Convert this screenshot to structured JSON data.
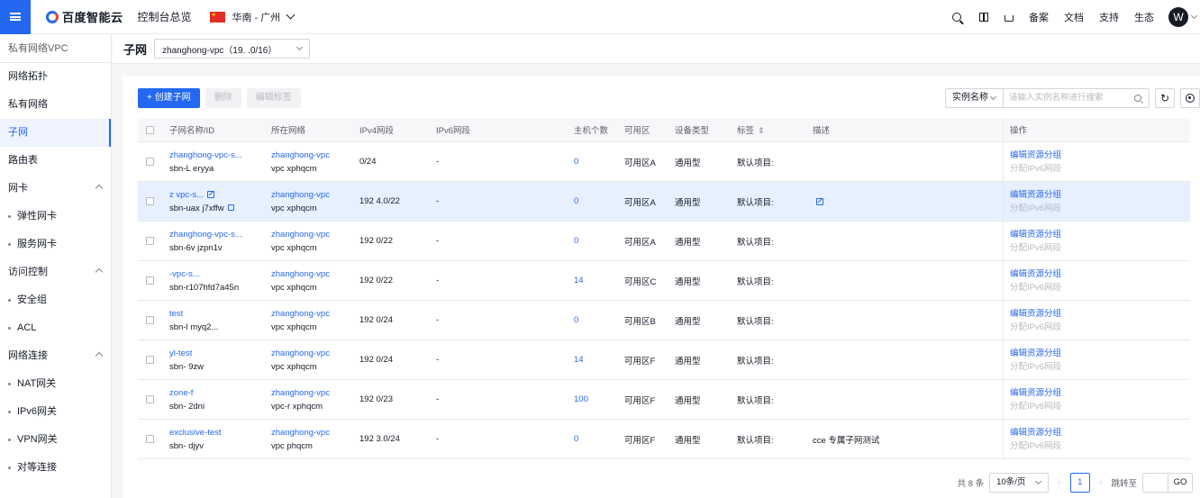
{
  "topbar": {
    "logo_text": "百度智能云",
    "console_label": "控制台总览",
    "region_label": "华南 - 广州",
    "links": [
      "备案",
      "文档",
      "支持",
      "生态"
    ],
    "avatar_letter": "W"
  },
  "sidebar": {
    "title": "私有网络VPC",
    "items": [
      {
        "label": "网络拓扑"
      },
      {
        "label": "私有网络"
      },
      {
        "label": "子网"
      },
      {
        "label": "路由表"
      },
      {
        "label": "网卡"
      },
      {
        "label": "弹性网卡"
      },
      {
        "label": "服务网卡"
      },
      {
        "label": "访问控制"
      },
      {
        "label": "安全组"
      },
      {
        "label": "ACL"
      },
      {
        "label": "网络连接"
      },
      {
        "label": "NAT网关"
      },
      {
        "label": "IPv6网关"
      },
      {
        "label": "VPN网关"
      },
      {
        "label": "对等连接"
      }
    ]
  },
  "main": {
    "title": "子网",
    "vpc_select_value": "zhanghong-vpc（19.       .0/16）"
  },
  "toolbar": {
    "create_label": "+ 创建子网",
    "delete_label": "删除",
    "edit_tags_label": "编辑标签",
    "filter_label": "实例名称",
    "search_placeholder": "请输入实例名称进行搜索"
  },
  "table": {
    "headers": {
      "name": "子网名称/ID",
      "vpc": "所在网络",
      "ipv4": "IPv4网段",
      "ipv6": "IPv6网段",
      "hosts": "主机个数",
      "zone": "可用区",
      "type": "设备类型",
      "tag": "标签",
      "desc": "描述",
      "ops": "操作"
    },
    "rows": [
      {
        "name": "zhanghong-vpc-s...",
        "id": "sbn-L        eryya",
        "vpc": "zhanghong-vpc",
        "vpc_id": "vpc        xphqcm",
        "ipv4": "        0/24",
        "ipv6": "-",
        "hosts": "0",
        "zone": "可用区A",
        "type": "通用型",
        "tag": "默认项目:",
        "desc": "",
        "op1": "编辑资源分组",
        "op2": "分配IPv6网段"
      },
      {
        "name": "z            vpc-s...",
        "id": "sbn-uax      j7xffw",
        "vpc": "zhanghong-vpc",
        "vpc_id": "vpc        xphqcm",
        "ipv4": "192        4.0/22",
        "ipv6": "-",
        "hosts": "0",
        "zone": "可用区A",
        "type": "通用型",
        "tag": "默认项目:",
        "desc": "",
        "op1": "编辑资源分组",
        "op2": "分配IPv6网段"
      },
      {
        "name": "zhanghong-vpc-s...",
        "id": "sbn-6v      jzpn1v",
        "vpc": "zhanghong-vpc",
        "vpc_id": "vpc        xphqcm",
        "ipv4": "192        0/22",
        "ipv6": "-",
        "hosts": "0",
        "zone": "可用区A",
        "type": "通用型",
        "tag": "默认项目:",
        "desc": "",
        "op1": "编辑资源分组",
        "op2": "分配IPv6网段"
      },
      {
        "name": "            -vpc-s...",
        "id": "sbn-r107hfd7a45n",
        "vpc": "zhanghong-vpc",
        "vpc_id": "vpc        xphqcm",
        "ipv4": "192        0/22",
        "ipv6": "-",
        "hosts": "14",
        "zone": "可用区C",
        "type": "通用型",
        "tag": "默认项目:",
        "desc": "",
        "op1": "编辑资源分组",
        "op2": "分配IPv6网段"
      },
      {
        "name": "test",
        "id": "sbn-l        myq2...",
        "vpc": "zhanghong-vpc",
        "vpc_id": "vpc        xphqcm",
        "ipv4": "192        0/24",
        "ipv6": "-",
        "hosts": "0",
        "zone": "可用区B",
        "type": "通用型",
        "tag": "默认项目:",
        "desc": "",
        "op1": "编辑资源分组",
        "op2": "分配IPv6网段"
      },
      {
        "name": "yl-test",
        "id": "sbn-         9zw",
        "vpc": "zhanghong-vpc",
        "vpc_id": "vpc        xphqcm",
        "ipv4": "192        0/24",
        "ipv6": "-",
        "hosts": "14",
        "zone": "可用区F",
        "type": "通用型",
        "tag": "默认项目:",
        "desc": "",
        "op1": "编辑资源分组",
        "op2": "分配IPv6网段"
      },
      {
        "name": "zone-f",
        "id": "sbn-        2dni",
        "vpc": "zhanghong-vpc",
        "vpc_id": "vpc-r      xphqcm",
        "ipv4": "192        0/23",
        "ipv6": "-",
        "hosts": "100",
        "zone": "可用区F",
        "type": "通用型",
        "tag": "默认项目:",
        "desc": "",
        "op1": "编辑资源分组",
        "op2": "分配IPv6网段"
      },
      {
        "name": "exclusive-test",
        "id": "sbn-        djyv",
        "vpc": "zhanghong-vpc",
        "vpc_id": "vpc        phqcm",
        "ipv4": "192        3.0/24",
        "ipv6": "-",
        "hosts": "0",
        "zone": "可用区F",
        "type": "通用型",
        "tag": "默认项目:",
        "desc": "cce 专属子网测试",
        "op1": "编辑资源分组",
        "op2": "分配IPv6网段"
      }
    ]
  },
  "pagination": {
    "total_label": "共 8 条",
    "page_size": "10条/页",
    "current_page": "1",
    "jump_label": "跳转至",
    "go_label": "GO"
  },
  "colors": {
    "accent": "#2468f2",
    "highlight_row": "#e6f0ff"
  }
}
